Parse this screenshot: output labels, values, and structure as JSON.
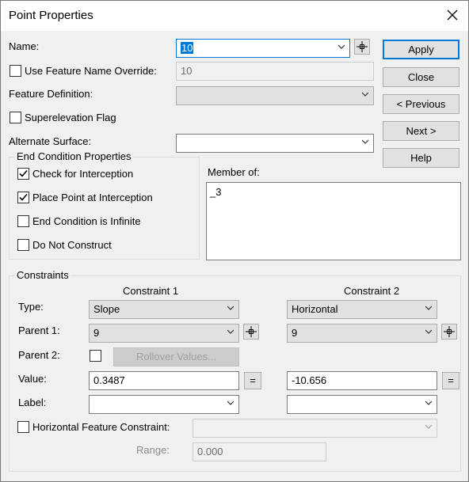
{
  "window": {
    "title": "Point Properties"
  },
  "fields": {
    "name_label": "Name:",
    "name_value": "10",
    "use_override_label": "Use Feature Name Override:",
    "override_value": "10",
    "feature_def_label": "Feature Definition:",
    "feature_def_value": "",
    "superelevation_label": "Superelevation Flag",
    "alt_surface_label": "Alternate Surface:",
    "alt_surface_value": ""
  },
  "buttons": {
    "apply": "Apply",
    "close": "Close",
    "previous": "< Previous",
    "next": "Next >",
    "help": "Help"
  },
  "end_condition": {
    "title": "End Condition Properties",
    "check_interception": {
      "label": "Check for Interception",
      "checked": true
    },
    "place_point": {
      "label": "Place Point at Interception",
      "checked": true
    },
    "is_infinite": {
      "label": "End Condition is Infinite",
      "checked": false
    },
    "do_not_construct": {
      "label": "Do Not Construct",
      "checked": false
    }
  },
  "member_of": {
    "label": "Member of:",
    "value": "_3"
  },
  "constraints": {
    "title": "Constraints",
    "col1_header": "Constraint 1",
    "col2_header": "Constraint 2",
    "type_label": "Type:",
    "parent1_label": "Parent 1:",
    "parent2_label": "Parent 2:",
    "value_label": "Value:",
    "label_label": "Label:",
    "c1": {
      "type": "Slope",
      "parent1": "9",
      "value": "0.3487",
      "label": ""
    },
    "c2": {
      "type": "Horizontal",
      "parent1": "9",
      "value": "-10.656",
      "label": ""
    },
    "rollover_button": "Rollover Values...",
    "equals": "=",
    "horizontal_feature_label": "Horizontal Feature Constraint:",
    "range_label": "Range:",
    "range_value": "0.000"
  },
  "icons": {
    "close": "close-icon",
    "dropdown": "chevron-down-icon",
    "pick": "crosshair-pick-icon",
    "check": "checkmark-icon"
  },
  "colors": {
    "accent": "#0078d7",
    "selection": "#0078d7"
  }
}
